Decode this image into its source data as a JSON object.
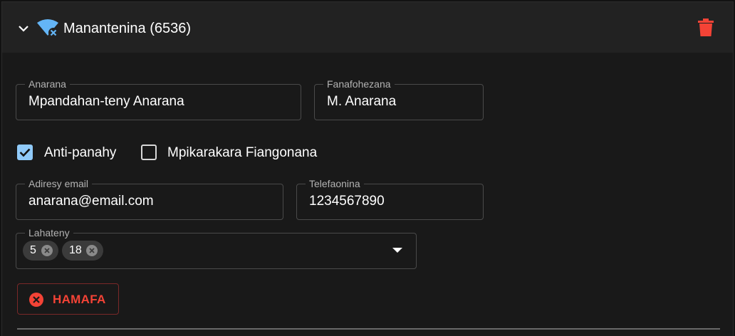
{
  "header": {
    "title": "Manantenina (6536)",
    "collapse_icon": "chevron-down-icon",
    "status_icon": "wifi-off-icon",
    "delete_icon": "trash-icon",
    "delete_color": "#f44336"
  },
  "form": {
    "name": {
      "label": "Anarana",
      "value": "Mpandahan-teny Anarana"
    },
    "abbreviation": {
      "label": "Fanafohezana",
      "value": "M. Anarana"
    },
    "checkboxes": [
      {
        "label": "Anti-panahy",
        "checked": true
      },
      {
        "label": "Mpikarakara Fiangonana",
        "checked": false
      }
    ],
    "email": {
      "label": "Adiresy email",
      "value": "anarana@email.com"
    },
    "phone": {
      "label": "Telefaonina",
      "value": "1234567890"
    },
    "list": {
      "label": "Lahateny",
      "chips": [
        "5",
        "18"
      ]
    }
  },
  "actions": {
    "cancel_label": "HAMAFA",
    "cancel_icon": "cancel-circle-icon"
  },
  "colors": {
    "accent": "#90caf9",
    "danger": "#f44336"
  }
}
